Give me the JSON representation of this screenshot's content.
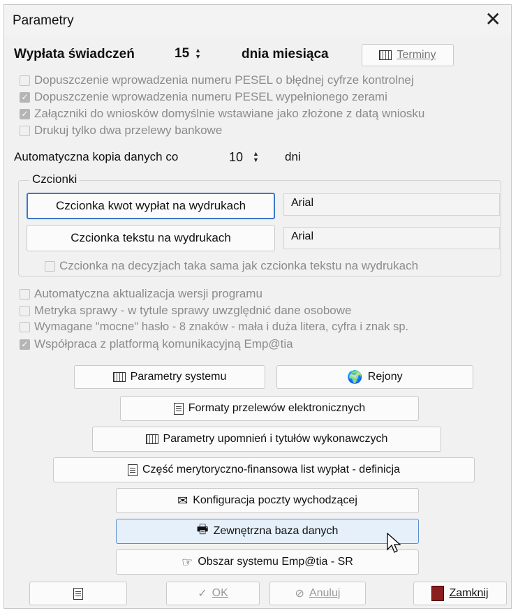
{
  "window": {
    "title": "Parametry"
  },
  "payout": {
    "label": "Wypłata świadczeń",
    "value": "15",
    "suffix": "dnia miesiąca",
    "terms_button": "Terminy"
  },
  "checks_top": [
    {
      "label": "Dopuszczenie wprowadzenia numeru PESEL o błędnej cyfrze kontrolnej",
      "checked": false
    },
    {
      "label": "Dopuszczenie wprowadzenia numeru PESEL wypełnionego zerami",
      "checked": true
    },
    {
      "label": "Załączniki do wniosków domyślnie wstawiane jako złożone z datą wniosku",
      "checked": true
    },
    {
      "label": "Drukuj tylko dwa przelewy bankowe",
      "checked": false
    }
  ],
  "backup": {
    "label": "Automatyczna kopia danych co",
    "value": "10",
    "suffix": "dni"
  },
  "fonts": {
    "group_label": "Czcionki",
    "amount_button": "Czcionka kwot wypłat na wydrukach",
    "amount_value": "Arial",
    "text_button": "Czcionka tekstu na wydrukach",
    "text_value": "Arial",
    "same_check": "Czcionka na decyzjach taka sama jak czcionka tekstu na wydrukach"
  },
  "checks_bottom": [
    {
      "label": "Automatyczna aktualizacja wersji programu",
      "checked": false
    },
    {
      "label": "Metryka sprawy - w tytule sprawy uwzględnić dane osobowe",
      "checked": false
    },
    {
      "label": "Wymagane \"mocne\" hasło - 8 znaków - mała i duża litera, cyfra i znak sp.",
      "checked": false
    },
    {
      "label": "Współpraca z platformą komunikacyjną Emp@tia",
      "checked": true
    }
  ],
  "buttons": {
    "system_params": "Parametry systemu",
    "regions": "Rejony",
    "transfer_formats": "Formaty przelewów elektronicznych",
    "reminder_params": "Parametry upomnień i tytułów wykonawczych",
    "payroll_part": "Część merytoryczno-finansowa list wypłat - definicja",
    "mail_config": "Konfiguracja poczty wychodzącej",
    "external_db": "Zewnętrzna baza danych",
    "empatia_area": "Obszar systemu Emp@tia - SR",
    "ok": "OK",
    "cancel": "Anuluj",
    "close": "Zamknij"
  },
  "icons": {
    "close": "close-icon",
    "calendar": "calendar-icon",
    "grid": "table-icon",
    "regions": "globe-icon",
    "docs": "documents-icon",
    "mail": "envelope-icon",
    "printer": "printer-icon",
    "hand": "pointing-hand-icon",
    "clipboard": "clipboard-icon",
    "check": "checkmark-icon",
    "cancel": "cancel-icon",
    "door": "door-icon"
  },
  "colors": {
    "focus_border": "#3b78c9",
    "hover_bg": "#e6f0fb",
    "disabled_text": "#8b8b8b"
  }
}
